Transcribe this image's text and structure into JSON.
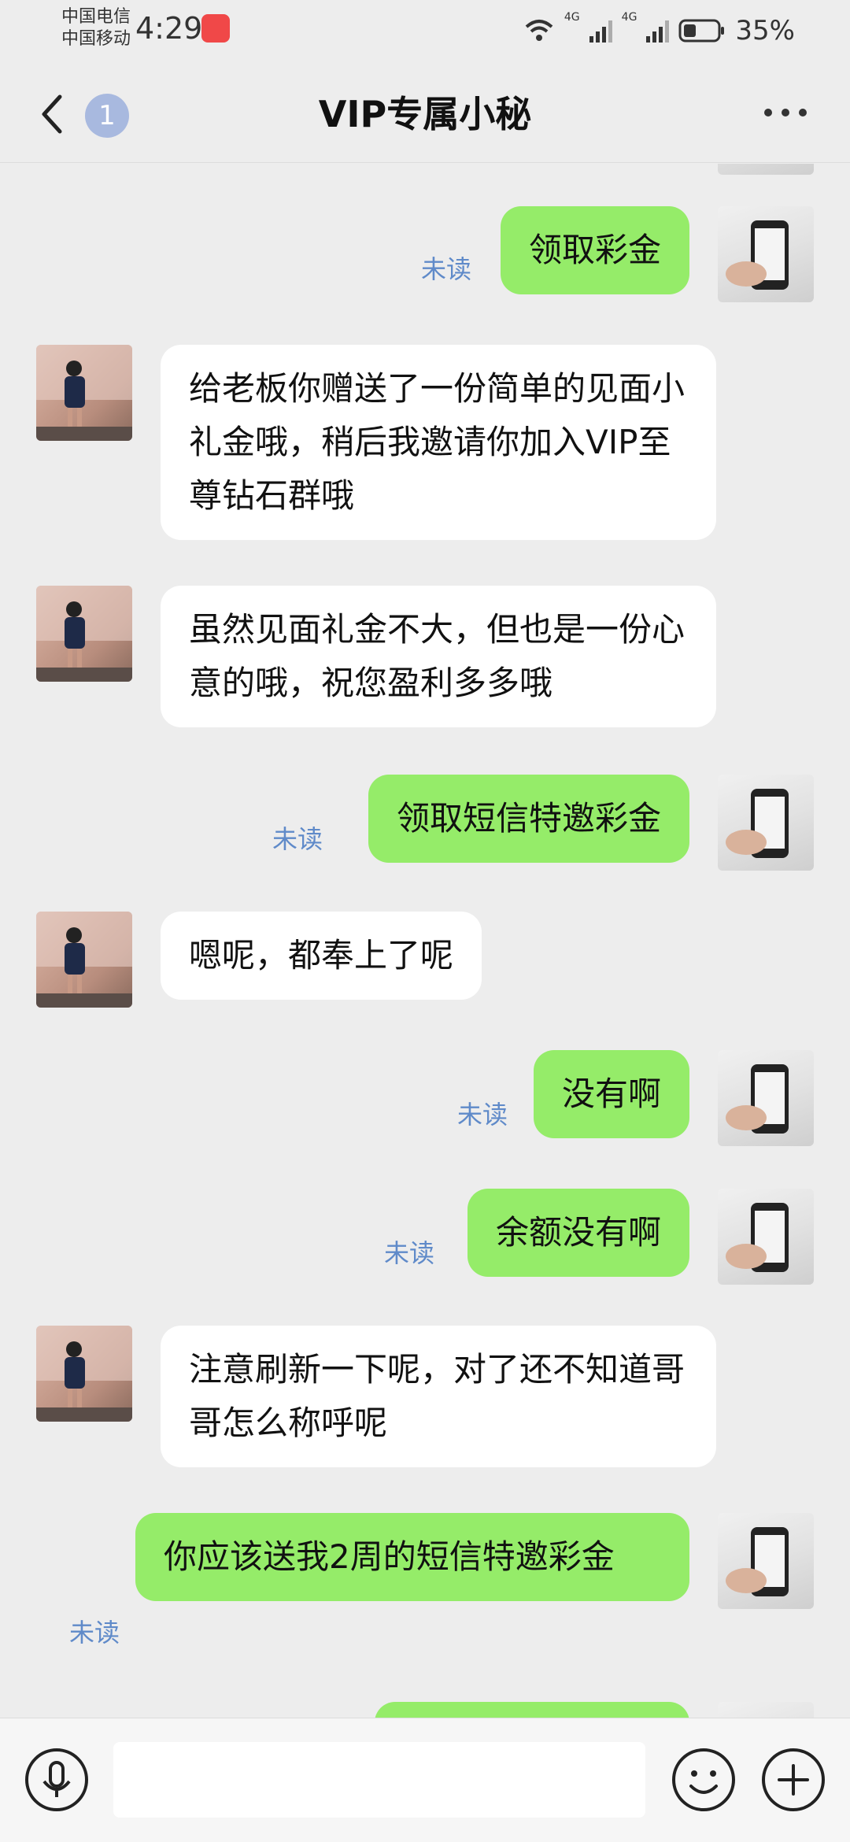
{
  "status_bar": {
    "carrier1": "中国电信",
    "carrier2": "中国移动",
    "time": "4:29",
    "network1": "4G",
    "network2": "4G",
    "battery": "35%"
  },
  "header": {
    "title": "VIP专属小秘",
    "unread_count": "1"
  },
  "messages": [
    {
      "side": "out",
      "text": "领取彩金",
      "status": "未读"
    },
    {
      "side": "in",
      "text": "给老板你赠送了一份简单的见面小礼金哦，稍后我邀请你加入VIP至尊钻石群哦"
    },
    {
      "side": "in",
      "text": "虽然见面礼金不大，但也是一份心意的哦，祝您盈利多多哦"
    },
    {
      "side": "out",
      "text": "领取短信特邀彩金",
      "status": "未读"
    },
    {
      "side": "in",
      "text": "嗯呢，都奉上了呢"
    },
    {
      "side": "out",
      "text": "没有啊",
      "status": "未读"
    },
    {
      "side": "out",
      "text": "余额没有啊",
      "status": "未读"
    },
    {
      "side": "in",
      "text": "注意刷新一下呢，对了还不知道哥哥怎么称呼呢"
    },
    {
      "side": "out",
      "text": "你应该送我2周的短信特邀彩金",
      "status": "未读"
    }
  ],
  "colors": {
    "outgoing_bubble": "#95ec69",
    "incoming_bubble": "#ffffff",
    "unread_text": "#5f8ac9",
    "background": "#ededed"
  },
  "icons": {
    "back": "chevron-left-icon",
    "more": "more-dots-icon",
    "voice": "microphone-icon",
    "emoji": "smiley-icon",
    "plus": "plus-icon"
  }
}
